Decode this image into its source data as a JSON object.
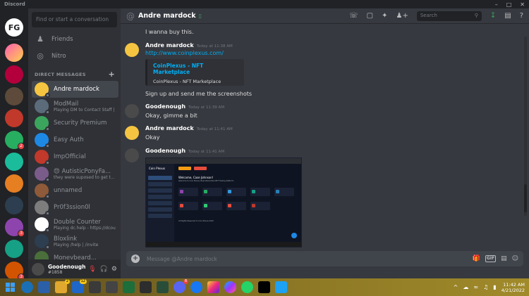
{
  "window": {
    "app_title": "Discord",
    "minimize": "–",
    "maximize": "□",
    "close": "✕"
  },
  "sidebar": {
    "search_placeholder": "Find or start a conversation",
    "nav": [
      {
        "label": "Friends",
        "icon": "friends-icon"
      },
      {
        "label": "Nitro",
        "icon": "nitro-icon"
      }
    ],
    "dm_header": "DIRECT MESSAGES",
    "dms": [
      {
        "name": "Andre mardock",
        "sub": "",
        "active": true,
        "color": "#f5c542"
      },
      {
        "name": "ModMail",
        "sub": "Playing DM to Contact Staff | ...",
        "color": "#5b6b7a"
      },
      {
        "name": "Security Premium",
        "sub": "",
        "color": "#3ba55d"
      },
      {
        "name": "Easy Auth",
        "sub": "",
        "color": "#1e88e5"
      },
      {
        "name": "ImpOfficial",
        "sub": "",
        "color": "#c0392b"
      },
      {
        "name": "😍 AutisticPonyFa...",
        "sub": "they were suposed to get t...",
        "color": "#7a5c8a"
      },
      {
        "name": "unnamed",
        "sub": "",
        "color": "#8e5a3a"
      },
      {
        "name": "Pr0f3ssion0l",
        "sub": "",
        "color": "#7d7d7d"
      },
      {
        "name": "Double Counter",
        "sub": "Playing dc.help - https://dcoun...",
        "color": "#ffffff"
      },
      {
        "name": "Bloxlink",
        "sub": "Playing /help | /invite",
        "color": "#2c3e50"
      },
      {
        "name": "Moneybeard...",
        "sub": "",
        "color": "#4a6f3a"
      }
    ]
  },
  "user_panel": {
    "name": "Goodenough",
    "tag": "#1858"
  },
  "chat": {
    "recipient": "Andre mardock",
    "search_placeholder": "Search",
    "composer_placeholder": "Message @Andre mardock",
    "messages": [
      {
        "author": "",
        "timestamp": "",
        "text": "I wanna buy this."
      },
      {
        "author": "Andre mardock",
        "timestamp": "Today at 11:38 AM",
        "link": "http://www.coinplexus.com/",
        "embed_title": "CoinPlexus - NFT Marketplace",
        "embed_desc": "CoinPlexus - NFT Marketplace",
        "text": "Sign up and send me the screenshots"
      },
      {
        "author": "Goodenough",
        "timestamp": "Today at 11:39 AM",
        "text": "Okay, gimme a bit"
      },
      {
        "author": "Andre mardock",
        "timestamp": "Today at 11:41 AM",
        "text": "Okay"
      },
      {
        "author": "Goodenough",
        "timestamp": "Today at 11:41 AM",
        "text": ""
      }
    ],
    "screenshot": {
      "app_name": "Coin Plexus",
      "welcome": "Welcome, Case Johnson!",
      "subtitle": "Welcome to Coin Plexus. Best alternative NFT Trading Platform",
      "footer": "All Rights Reserved to Coin Plexus 2022"
    }
  },
  "taskbar": {
    "badges": {
      "files": "2",
      "mail": "12",
      "discord": "8"
    },
    "time": "11:42 AM",
    "date": "4/21/2022"
  },
  "guild_badges": [
    "2",
    "3",
    "3"
  ]
}
